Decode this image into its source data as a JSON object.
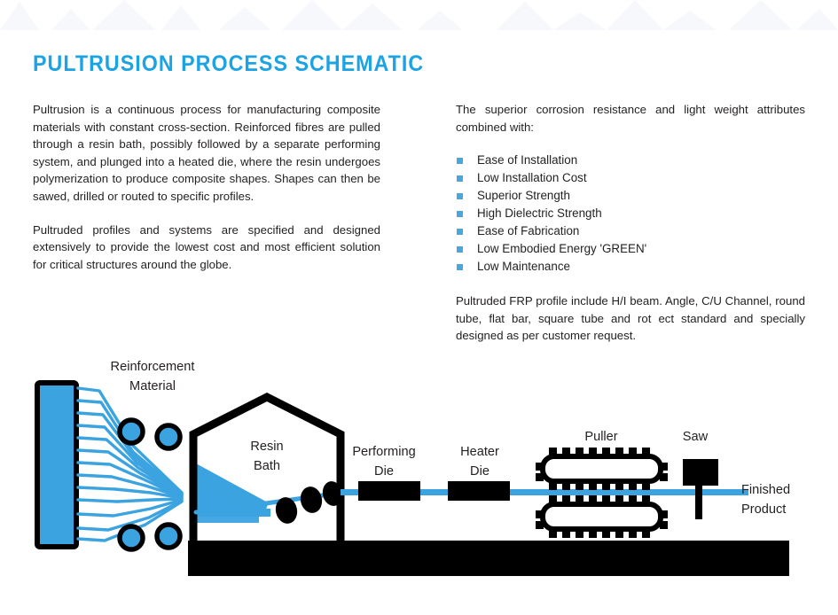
{
  "page": {
    "title": "PULTRUSION PROCESS SCHEMATIC",
    "accent_color": "#1ca3e3",
    "diagram_blue": "#3ba3e0",
    "bullet_color": "#4aa6dd",
    "ink_color": "#221f1f"
  },
  "left_column": {
    "paragraphs": [
      "Pultrusion is a continuous process for manufacturing composite materials with constant cross-section. Reinforced fibres are pulled through a resin bath, possibly followed by a separate performing system, and plunged into a heated die, where the resin undergoes polymerization to produce composite shapes. Shapes can then be sawed, drilled or routed to specific profiles.",
      "Pultruded profiles and systems are specified and designed extensively to provide the lowest cost and most efficient solution for critical structures around the globe."
    ]
  },
  "right_column": {
    "intro": "The superior corrosion resistance and light weight attributes combined with:",
    "bullets": [
      "Ease of Installation",
      "Low Installation Cost",
      "Superior Strength",
      "High Dielectric Strength",
      "Ease of Fabrication",
      "Low Embodied Energy 'GREEN'",
      "Low Maintenance"
    ],
    "outro": "Pultruded FRP profile include H/I beam. Angle, C/U Channel, round tube, flat bar, square tube and rot ect standard and specially designed as per customer request."
  },
  "diagram": {
    "labels": {
      "reinforcement_line1": "Reinforcement",
      "reinforcement_line2": "Material",
      "resin_line1": "Resin",
      "resin_line2": "Bath",
      "performing_line1": "Performing",
      "performing_line2": "Die",
      "heater_line1": "Heater",
      "heater_line2": "Die",
      "puller": "Puller",
      "saw": "Saw",
      "finished_line1": "Finished",
      "finished_line2": "Product"
    }
  }
}
